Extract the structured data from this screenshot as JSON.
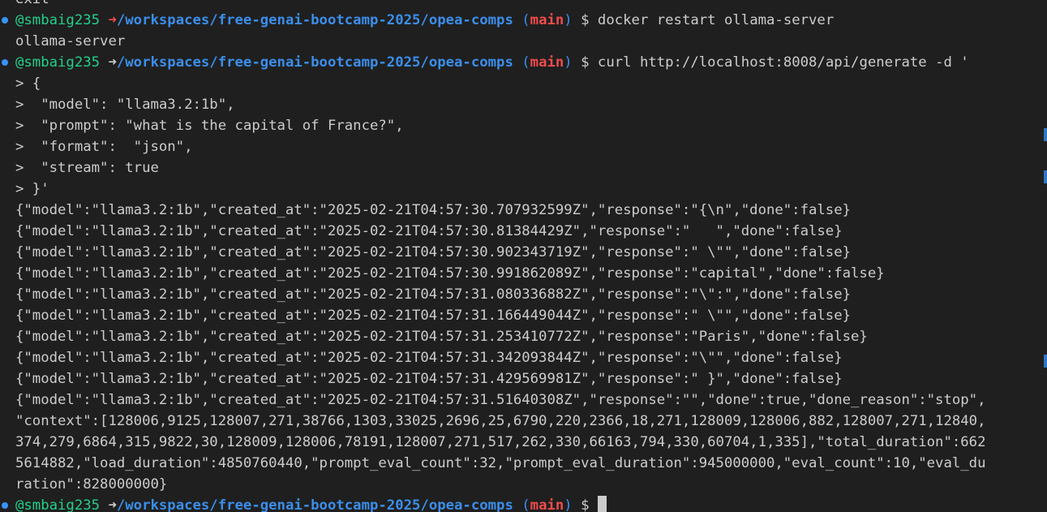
{
  "prompt": {
    "user": "@smbaig235",
    "arrow": "➜",
    "path": "/workspaces/free-genai-bootcamp-2025/opea-comps",
    "paren_open": "(",
    "branch": "main",
    "paren_close": ")",
    "symbol": "$"
  },
  "lines": {
    "exit": "exit",
    "cmd1": "docker restart ollama-server",
    "out1": "ollama-server",
    "cmd2": "curl http://localhost:8008/api/generate -d '",
    "body": [
      "> {",
      ">  \"model\": \"llama3.2:1b\",",
      ">  \"prompt\": \"what is the capital of France?\",",
      ">  \"format\":  \"json\",",
      ">  \"stream\": true",
      "> }'"
    ],
    "responses": [
      "{\"model\":\"llama3.2:1b\",\"created_at\":\"2025-02-21T04:57:30.707932599Z\",\"response\":\"{\\n\",\"done\":false}",
      "{\"model\":\"llama3.2:1b\",\"created_at\":\"2025-02-21T04:57:30.81384429Z\",\"response\":\"   \",\"done\":false}",
      "{\"model\":\"llama3.2:1b\",\"created_at\":\"2025-02-21T04:57:30.902343719Z\",\"response\":\" \\\"\",\"done\":false}",
      "{\"model\":\"llama3.2:1b\",\"created_at\":\"2025-02-21T04:57:30.991862089Z\",\"response\":\"capital\",\"done\":false}",
      "{\"model\":\"llama3.2:1b\",\"created_at\":\"2025-02-21T04:57:31.080336882Z\",\"response\":\"\\\":\",\"done\":false}",
      "{\"model\":\"llama3.2:1b\",\"created_at\":\"2025-02-21T04:57:31.166449044Z\",\"response\":\" \\\"\",\"done\":false}",
      "{\"model\":\"llama3.2:1b\",\"created_at\":\"2025-02-21T04:57:31.253410772Z\",\"response\":\"Paris\",\"done\":false}",
      "{\"model\":\"llama3.2:1b\",\"created_at\":\"2025-02-21T04:57:31.342093844Z\",\"response\":\"\\\"\",\"done\":false}",
      "{\"model\":\"llama3.2:1b\",\"created_at\":\"2025-02-21T04:57:31.429569981Z\",\"response\":\" }\",\"done\":false}"
    ],
    "final": [
      "{\"model\":\"llama3.2:1b\",\"created_at\":\"2025-02-21T04:57:31.51640308Z\",\"response\":\"\",\"done\":true,\"done_reason\":\"stop\",",
      "\"context\":[128006,9125,128007,271,38766,1303,33025,2696,25,6790,220,2366,18,271,128009,128006,882,128007,271,12840,",
      "374,279,6864,315,9822,30,128009,128006,78191,128007,271,517,262,330,66163,794,330,60704,1,335],\"total_duration\":662",
      "5614882,\"load_duration\":4850760440,\"prompt_eval_count\":32,\"prompt_eval_duration\":945000000,\"eval_count\":10,\"eval_du",
      "ration\":828000000}"
    ]
  },
  "colors": {
    "background": "#1f1f1f",
    "text": "#cccccc",
    "user": "#23d18b",
    "path": "#3b8eea",
    "branch": "#f14c4c",
    "error_arrow": "#f14c4c",
    "gutter_dot": "#3794ff"
  }
}
